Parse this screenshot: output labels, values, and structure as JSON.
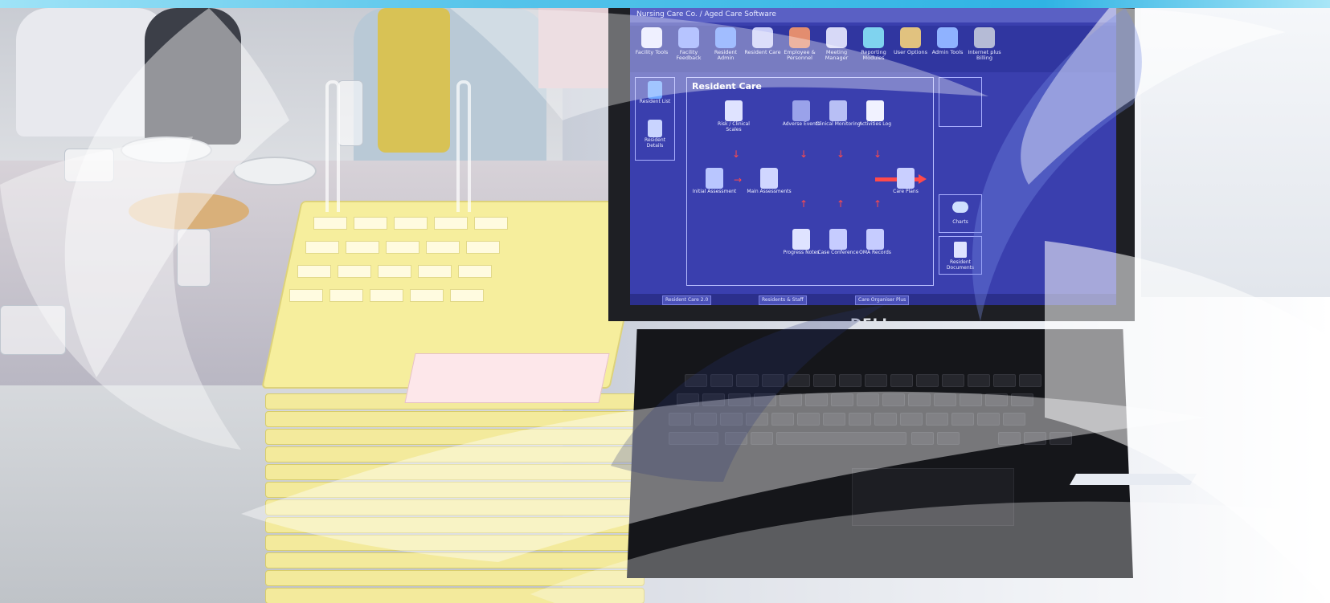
{
  "colors": {
    "screen_bg": "#3a3fae",
    "accent_arrow": "#ff4a4a",
    "tray_yellow": "#f3ea9c",
    "topbar": [
      "#7fd3ef",
      "#3fb8e6",
      "#97e0f5"
    ]
  },
  "laptop": {
    "brand": "DELL",
    "window_title": "Nursing Care Co. / Aged Care Software",
    "toolbar": [
      {
        "label": "Facility Tools",
        "icon": "house-icon"
      },
      {
        "label": "Facility Feedback",
        "icon": "feedback-icon"
      },
      {
        "label": "Resident Admin",
        "icon": "resident-admin-icon"
      },
      {
        "label": "Resident Care",
        "icon": "resident-care-icon"
      },
      {
        "label": "Employee & Personnel",
        "icon": "employees-icon"
      },
      {
        "label": "Meeting Manager",
        "icon": "meeting-icon"
      },
      {
        "label": "Reporting Modules",
        "icon": "reports-icon"
      },
      {
        "label": "User Options",
        "icon": "user-options-icon"
      },
      {
        "label": "Admin Tools",
        "icon": "admin-tools-icon"
      },
      {
        "label": "Internet plus Billing",
        "icon": "billing-icon"
      }
    ],
    "left_pane": [
      {
        "label": "Resident List",
        "icon": "resident-list-icon"
      },
      {
        "label": "Resident Details",
        "icon": "resident-details-icon"
      }
    ],
    "panel_title": "Resident Care",
    "nodes": [
      {
        "label": "Risk / Clinical Scales",
        "icon": "risk-scales-icon"
      },
      {
        "label": "Adverse Events",
        "icon": "adverse-events-icon"
      },
      {
        "label": "Clinical Monitoring",
        "icon": "clinical-monitoring-icon"
      },
      {
        "label": "Activities Log",
        "icon": "activities-log-icon"
      },
      {
        "label": "Initial Assessment",
        "icon": "initial-assessment-icon"
      },
      {
        "label": "Main Assessments",
        "icon": "main-assessments-icon"
      },
      {
        "label": "Care Plans",
        "icon": "care-plans-icon"
      },
      {
        "label": "Progress Notes",
        "icon": "progress-notes-icon"
      },
      {
        "label": "Case Conference",
        "icon": "case-conference-icon"
      },
      {
        "label": "OMA Records",
        "icon": "oma-records-icon"
      }
    ],
    "side_boxes": [
      {
        "label": "Charts",
        "icon": "charts-icon"
      },
      {
        "label": "Resident Documents",
        "icon": "resident-documents-icon"
      }
    ],
    "taskbar": [
      "Resident Care 2.0",
      "Residents & Staff",
      "Care Organiser Plus"
    ]
  }
}
